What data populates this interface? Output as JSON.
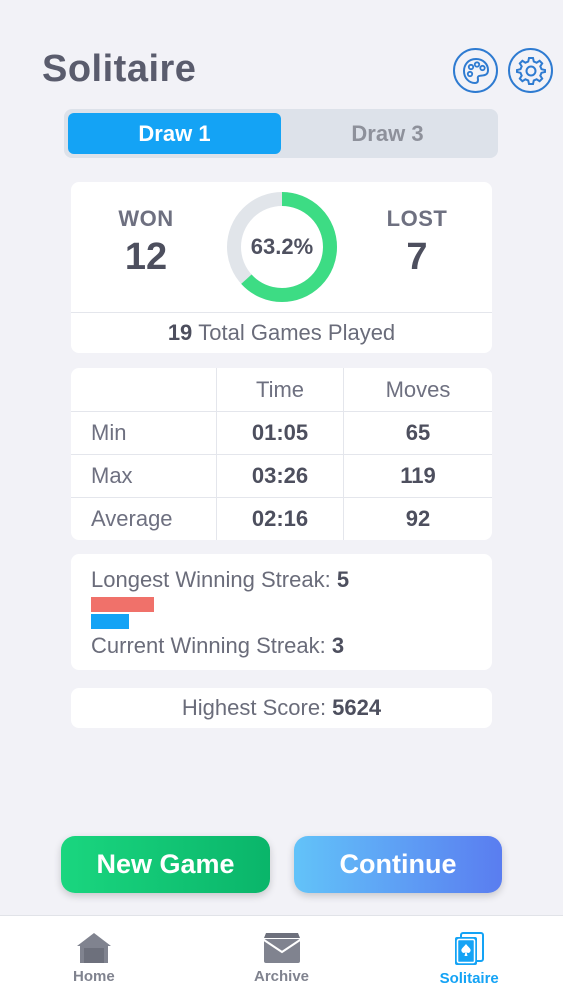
{
  "header": {
    "title": "Solitaire",
    "icons": [
      "palette-icon",
      "gear-icon"
    ]
  },
  "mode_tabs": [
    {
      "label": "Draw 1",
      "active": true
    },
    {
      "label": "Draw 3",
      "active": false
    }
  ],
  "summary": {
    "won_label": "WON",
    "won_value": "12",
    "lost_label": "LOST",
    "lost_value": "7",
    "win_percent_text": "63.2%",
    "win_fraction": 0.632,
    "total_games": "19",
    "total_games_label": "Total Games Played"
  },
  "table": {
    "headers": [
      "",
      "Time",
      "Moves"
    ],
    "rows": [
      {
        "label": "Min",
        "time": "01:05",
        "moves": "65"
      },
      {
        "label": "Max",
        "time": "03:26",
        "moves": "119"
      },
      {
        "label": "Average",
        "time": "02:16",
        "moves": "92"
      }
    ]
  },
  "streaks": {
    "longest_label": "Longest Winning Streak:",
    "longest_value": "5",
    "current_label": "Current Winning Streak:",
    "current_value": "3"
  },
  "score": {
    "label": "Highest Score:",
    "value": "5624"
  },
  "buttons": {
    "new_game": "New Game",
    "continue": "Continue"
  },
  "nav": [
    {
      "label": "Home",
      "icon": "home-icon",
      "active": false
    },
    {
      "label": "Archive",
      "icon": "archive-icon",
      "active": false
    },
    {
      "label": "Solitaire",
      "icon": "cards-icon",
      "active": true
    }
  ],
  "colors": {
    "accent": "#14a3f5",
    "ring_won": "#3ddc84",
    "ring_track": "#e1e5ea",
    "longest_bar": "#f0716a",
    "current_bar": "#14a3f5"
  }
}
